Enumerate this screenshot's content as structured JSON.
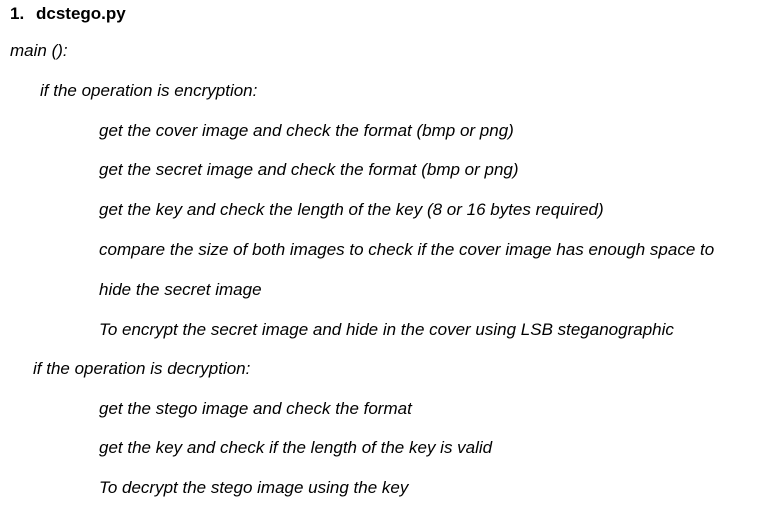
{
  "heading": {
    "number": "1.",
    "title": "dcstego.py"
  },
  "lines": {
    "main": "main ():",
    "if_encryption": "if the operation is encryption:",
    "enc_1": "get the cover image and check the format (bmp or png)",
    "enc_2": "get the secret image and check the format (bmp or png)",
    "enc_3": "get the key and check the length of the key (8 or 16 bytes required)",
    "enc_4a": "compare the size of both images to check if the cover image has enough space to",
    "enc_4b": "hide the secret image",
    "enc_5": "To encrypt the secret image and hide in the cover using LSB steganographic",
    "if_decryption": "if the operation is decryption:",
    "dec_1": "get the stego image and check the format",
    "dec_2": "get the key and check if the length of the key is valid",
    "dec_3": "To decrypt the stego image using the key"
  }
}
